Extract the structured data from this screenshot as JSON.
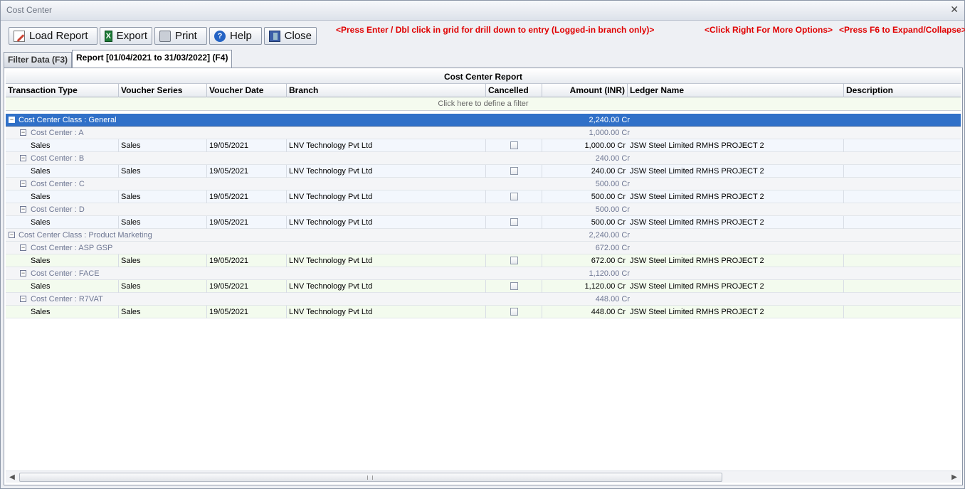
{
  "window": {
    "title": "Cost Center",
    "close_glyph": "✕"
  },
  "toolbar": {
    "buttons": [
      {
        "label": "Load Report",
        "icon": "load-report-icon"
      },
      {
        "label": "Export",
        "icon": "excel-icon"
      },
      {
        "label": "Print",
        "icon": "printer-icon"
      },
      {
        "label": "Help",
        "icon": "help-icon"
      },
      {
        "label": "Close",
        "icon": "exit-door-icon"
      }
    ],
    "hints": [
      "<Press Enter / Dbl click in grid for drill down to entry (Logged-in branch only)>",
      "<Click Right For More Options>",
      "<Press F6 to Expand/Collapse>"
    ]
  },
  "tabs": [
    {
      "label": "Filter Data (F3)",
      "active": false
    },
    {
      "label": "Report [01/04/2021 to 31/03/2022] (F4)",
      "active": true
    }
  ],
  "grid": {
    "band_title": "Cost Center Report",
    "columns": [
      "Transaction Type",
      "Voucher Series",
      "Voucher Date",
      "Branch",
      "Cancelled",
      "Amount (INR)",
      "Ledger Name",
      "Description"
    ],
    "filter_prompt": "Click here to define a filter",
    "class_general": {
      "label": "Cost Center Class : General",
      "amount": "2,240.00 Cr"
    },
    "cc_a": {
      "label": "Cost Center : A",
      "amount": "1,000.00 Cr"
    },
    "row_a": {
      "type": "Sales",
      "series": "Sales",
      "date": "19/05/2021",
      "branch": "LNV Technology Pvt Ltd",
      "amount": "1,000.00 Cr",
      "ledger": "JSW Steel Limited RMHS PROJECT 2"
    },
    "cc_b": {
      "label": "Cost Center : B",
      "amount": "240.00 Cr"
    },
    "row_b": {
      "type": "Sales",
      "series": "Sales",
      "date": "19/05/2021",
      "branch": "LNV Technology Pvt Ltd",
      "amount": "240.00 Cr",
      "ledger": "JSW Steel Limited RMHS PROJECT 2"
    },
    "cc_c": {
      "label": "Cost Center : C",
      "amount": "500.00 Cr"
    },
    "row_c": {
      "type": "Sales",
      "series": "Sales",
      "date": "19/05/2021",
      "branch": "LNV Technology Pvt Ltd",
      "amount": "500.00 Cr",
      "ledger": "JSW Steel Limited RMHS PROJECT 2"
    },
    "cc_d": {
      "label": "Cost Center : D",
      "amount": "500.00 Cr"
    },
    "row_d": {
      "type": "Sales",
      "series": "Sales",
      "date": "19/05/2021",
      "branch": "LNV Technology Pvt Ltd",
      "amount": "500.00 Cr",
      "ledger": "JSW Steel Limited RMHS PROJECT 2"
    },
    "class_pm": {
      "label": "Cost Center Class : Product Marketing",
      "amount": "2,240.00 Cr"
    },
    "cc_asp": {
      "label": "Cost Center : ASP GSP",
      "amount": "672.00 Cr"
    },
    "row_asp": {
      "type": "Sales",
      "series": "Sales",
      "date": "19/05/2021",
      "branch": "LNV Technology Pvt Ltd",
      "amount": "672.00 Cr",
      "ledger": "JSW Steel Limited RMHS PROJECT 2"
    },
    "cc_face": {
      "label": "Cost Center : FACE",
      "amount": "1,120.00 Cr"
    },
    "row_face": {
      "type": "Sales",
      "series": "Sales",
      "date": "19/05/2021",
      "branch": "LNV Technology Pvt Ltd",
      "amount": "1,120.00 Cr",
      "ledger": "JSW Steel Limited RMHS PROJECT 2"
    },
    "cc_r7": {
      "label": "Cost Center : R7VAT",
      "amount": "448.00 Cr"
    },
    "row_r7": {
      "type": "Sales",
      "series": "Sales",
      "date": "19/05/2021",
      "branch": "LNV Technology Pvt Ltd",
      "amount": "448.00 Cr",
      "ledger": "JSW Steel Limited RMHS PROJECT 2"
    }
  },
  "colors": {
    "selected_row": "#3070c8",
    "hint_text": "#e00000",
    "group_text": "#6e7793"
  }
}
